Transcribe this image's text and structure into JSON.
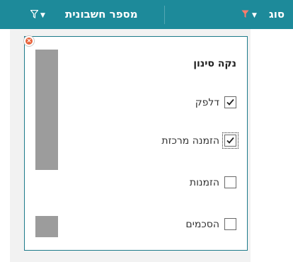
{
  "header": {
    "col_type_label": "סוג",
    "col_account_label": "מספר חשבונית"
  },
  "filter_popup": {
    "clear_filter_label": "נקה סינון",
    "options": [
      {
        "label": "דלפק",
        "checked": true
      },
      {
        "label": "הזמנה מרכזת",
        "checked": true,
        "focused": true
      },
      {
        "label": "הזמנות",
        "checked": false
      },
      {
        "label": "הסכמים",
        "checked": false
      }
    ]
  },
  "colors": {
    "header_bg": "#1d8a9a",
    "funnel_icon": "#ff7b6b",
    "close_icon": "#e8623a",
    "panel_border": "#1d7a8a",
    "scrollbar": "#9c9c9c"
  }
}
